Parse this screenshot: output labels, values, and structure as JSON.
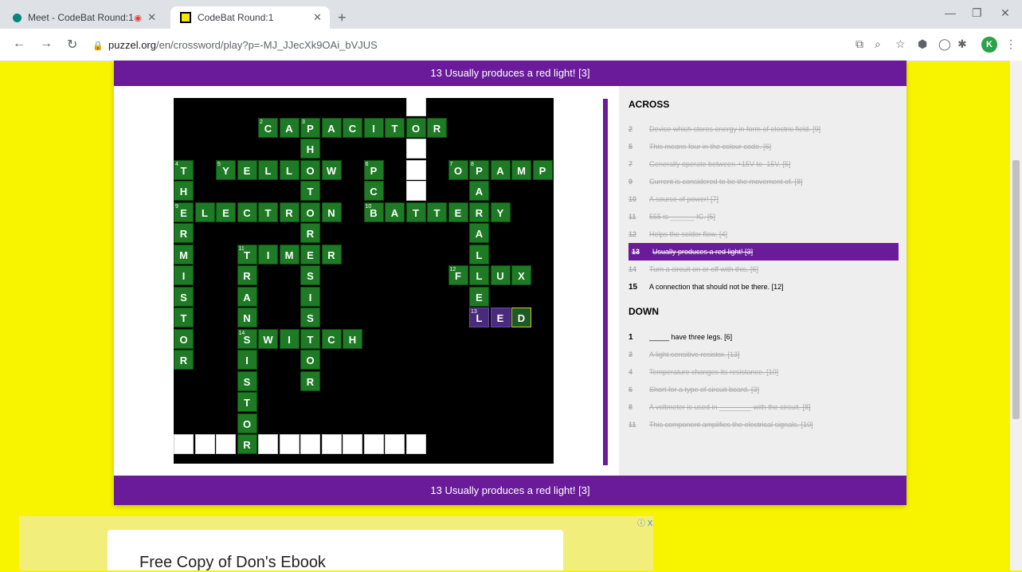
{
  "browser": {
    "tabs": [
      {
        "title": "Meet - CodeBat Round:1",
        "active": false
      },
      {
        "title": "CodeBat Round:1",
        "active": true
      }
    ],
    "url_host": "puzzel.org",
    "url_path": "/en/crossword/play?p=-MJ_JJecXk9OAi_bVJUS",
    "avatar_letter": "K"
  },
  "crossword": {
    "current_clue_banner": "13   Usually produces a red light! [3]",
    "across_heading": "ACROSS",
    "down_heading": "DOWN",
    "across": [
      {
        "n": "2",
        "text": "Device which stores energy in form of electric field. [9]",
        "state": "done"
      },
      {
        "n": "5",
        "text": "This means four in the colour code. [6]",
        "state": "done"
      },
      {
        "n": "7",
        "text": "Generally operate between +15V to -15V. [5]",
        "state": "done"
      },
      {
        "n": "9",
        "text": "Current is considered to be the movement of. [8]",
        "state": "done"
      },
      {
        "n": "10",
        "text": "A source of power! [7]",
        "state": "done"
      },
      {
        "n": "11",
        "text": "555 is ______ IC. [5]",
        "state": "done"
      },
      {
        "n": "12",
        "text": "Helps the solder flow. [4]",
        "state": "done"
      },
      {
        "n": "13",
        "text": "Usually produces a red light! [3]",
        "state": "active"
      },
      {
        "n": "14",
        "text": "Turn a circuit on or off with this. [6]",
        "state": "done"
      },
      {
        "n": "15",
        "text": "A connection that should not be there. [12]",
        "state": "open"
      }
    ],
    "down": [
      {
        "n": "1",
        "text": "_____ have three legs. [6]",
        "state": "open"
      },
      {
        "n": "3",
        "text": "A light sensitive resistor. [13]",
        "state": "done"
      },
      {
        "n": "4",
        "text": "Temperature changes its resistance. [10]",
        "state": "done"
      },
      {
        "n": "6",
        "text": "Short for a type of circuit board. [3]",
        "state": "done"
      },
      {
        "n": "8",
        "text": "A voltmeter is used in ________ with the circuit. [8]",
        "state": "done"
      },
      {
        "n": "11",
        "text": "This component amplifies the electrical signals. [10]",
        "state": "done"
      }
    ],
    "cells": [
      {
        "r": 0,
        "c": 11,
        "t": "white",
        "n": "1"
      },
      {
        "r": 1,
        "c": 4,
        "t": "green",
        "ch": "C",
        "n": "2"
      },
      {
        "r": 1,
        "c": 5,
        "t": "green",
        "ch": "A"
      },
      {
        "r": 1,
        "c": 6,
        "t": "green",
        "ch": "P",
        "n": "3"
      },
      {
        "r": 1,
        "c": 7,
        "t": "green",
        "ch": "A"
      },
      {
        "r": 1,
        "c": 8,
        "t": "green",
        "ch": "C"
      },
      {
        "r": 1,
        "c": 9,
        "t": "green",
        "ch": "I"
      },
      {
        "r": 1,
        "c": 10,
        "t": "green",
        "ch": "T"
      },
      {
        "r": 1,
        "c": 11,
        "t": "green",
        "ch": "O"
      },
      {
        "r": 1,
        "c": 12,
        "t": "green",
        "ch": "R"
      },
      {
        "r": 2,
        "c": 6,
        "t": "green",
        "ch": "H"
      },
      {
        "r": 2,
        "c": 11,
        "t": "white"
      },
      {
        "r": 3,
        "c": 0,
        "t": "green",
        "ch": "T",
        "n": "4"
      },
      {
        "r": 3,
        "c": 2,
        "t": "green",
        "ch": "Y",
        "n": "5"
      },
      {
        "r": 3,
        "c": 3,
        "t": "green",
        "ch": "E"
      },
      {
        "r": 3,
        "c": 4,
        "t": "green",
        "ch": "L"
      },
      {
        "r": 3,
        "c": 5,
        "t": "green",
        "ch": "L"
      },
      {
        "r": 3,
        "c": 6,
        "t": "green",
        "ch": "O"
      },
      {
        "r": 3,
        "c": 7,
        "t": "green",
        "ch": "W"
      },
      {
        "r": 3,
        "c": 9,
        "t": "green",
        "ch": "P",
        "n": "6"
      },
      {
        "r": 3,
        "c": 11,
        "t": "white"
      },
      {
        "r": 3,
        "c": 13,
        "t": "green",
        "ch": "O",
        "n": "7"
      },
      {
        "r": 3,
        "c": 14,
        "t": "green",
        "ch": "P",
        "n": "8"
      },
      {
        "r": 3,
        "c": 15,
        "t": "green",
        "ch": "A"
      },
      {
        "r": 3,
        "c": 16,
        "t": "green",
        "ch": "M"
      },
      {
        "r": 3,
        "c": 17,
        "t": "green",
        "ch": "P"
      },
      {
        "r": 4,
        "c": 0,
        "t": "green",
        "ch": "H"
      },
      {
        "r": 4,
        "c": 6,
        "t": "green",
        "ch": "T"
      },
      {
        "r": 4,
        "c": 9,
        "t": "green",
        "ch": "C"
      },
      {
        "r": 4,
        "c": 11,
        "t": "white"
      },
      {
        "r": 4,
        "c": 14,
        "t": "green",
        "ch": "A"
      },
      {
        "r": 5,
        "c": 0,
        "t": "green",
        "ch": "E",
        "n": "9"
      },
      {
        "r": 5,
        "c": 1,
        "t": "green",
        "ch": "L"
      },
      {
        "r": 5,
        "c": 2,
        "t": "green",
        "ch": "E"
      },
      {
        "r": 5,
        "c": 3,
        "t": "green",
        "ch": "C"
      },
      {
        "r": 5,
        "c": 4,
        "t": "green",
        "ch": "T"
      },
      {
        "r": 5,
        "c": 5,
        "t": "green",
        "ch": "R"
      },
      {
        "r": 5,
        "c": 6,
        "t": "green",
        "ch": "O"
      },
      {
        "r": 5,
        "c": 7,
        "t": "green",
        "ch": "N"
      },
      {
        "r": 5,
        "c": 9,
        "t": "green",
        "ch": "B",
        "n": "10"
      },
      {
        "r": 5,
        "c": 10,
        "t": "green",
        "ch": "A"
      },
      {
        "r": 5,
        "c": 11,
        "t": "green",
        "ch": "T"
      },
      {
        "r": 5,
        "c": 12,
        "t": "green",
        "ch": "T"
      },
      {
        "r": 5,
        "c": 13,
        "t": "green",
        "ch": "E"
      },
      {
        "r": 5,
        "c": 14,
        "t": "green",
        "ch": "R"
      },
      {
        "r": 5,
        "c": 15,
        "t": "green",
        "ch": "Y"
      },
      {
        "r": 6,
        "c": 0,
        "t": "green",
        "ch": "R"
      },
      {
        "r": 6,
        "c": 6,
        "t": "green",
        "ch": "R"
      },
      {
        "r": 6,
        "c": 14,
        "t": "green",
        "ch": "A"
      },
      {
        "r": 7,
        "c": 0,
        "t": "green",
        "ch": "M"
      },
      {
        "r": 7,
        "c": 3,
        "t": "green",
        "ch": "T",
        "n": "11"
      },
      {
        "r": 7,
        "c": 4,
        "t": "green",
        "ch": "I"
      },
      {
        "r": 7,
        "c": 5,
        "t": "green",
        "ch": "M"
      },
      {
        "r": 7,
        "c": 6,
        "t": "green",
        "ch": "E"
      },
      {
        "r": 7,
        "c": 7,
        "t": "green",
        "ch": "R"
      },
      {
        "r": 7,
        "c": 14,
        "t": "green",
        "ch": "L"
      },
      {
        "r": 8,
        "c": 0,
        "t": "green",
        "ch": "I"
      },
      {
        "r": 8,
        "c": 3,
        "t": "green",
        "ch": "R"
      },
      {
        "r": 8,
        "c": 6,
        "t": "green",
        "ch": "S"
      },
      {
        "r": 8,
        "c": 13,
        "t": "green",
        "ch": "F",
        "n": "12"
      },
      {
        "r": 8,
        "c": 14,
        "t": "green",
        "ch": "L"
      },
      {
        "r": 8,
        "c": 15,
        "t": "green",
        "ch": "U"
      },
      {
        "r": 8,
        "c": 16,
        "t": "green",
        "ch": "X"
      },
      {
        "r": 9,
        "c": 0,
        "t": "green",
        "ch": "S"
      },
      {
        "r": 9,
        "c": 3,
        "t": "green",
        "ch": "A"
      },
      {
        "r": 9,
        "c": 6,
        "t": "green",
        "ch": "I"
      },
      {
        "r": 9,
        "c": 14,
        "t": "green",
        "ch": "E"
      },
      {
        "r": 10,
        "c": 0,
        "t": "green",
        "ch": "T"
      },
      {
        "r": 10,
        "c": 3,
        "t": "green",
        "ch": "N"
      },
      {
        "r": 10,
        "c": 6,
        "t": "green",
        "ch": "S"
      },
      {
        "r": 10,
        "c": 14,
        "t": "purple",
        "ch": "L",
        "n": "13"
      },
      {
        "r": 10,
        "c": 15,
        "t": "purple",
        "ch": "E"
      },
      {
        "r": 10,
        "c": 16,
        "t": "hl",
        "ch": "D"
      },
      {
        "r": 11,
        "c": 0,
        "t": "green",
        "ch": "O"
      },
      {
        "r": 11,
        "c": 3,
        "t": "green",
        "ch": "S",
        "n": "14"
      },
      {
        "r": 11,
        "c": 4,
        "t": "green",
        "ch": "W"
      },
      {
        "r": 11,
        "c": 5,
        "t": "green",
        "ch": "I"
      },
      {
        "r": 11,
        "c": 6,
        "t": "green",
        "ch": "T"
      },
      {
        "r": 11,
        "c": 7,
        "t": "green",
        "ch": "C"
      },
      {
        "r": 11,
        "c": 8,
        "t": "green",
        "ch": "H"
      },
      {
        "r": 12,
        "c": 0,
        "t": "green",
        "ch": "R"
      },
      {
        "r": 12,
        "c": 3,
        "t": "green",
        "ch": "I"
      },
      {
        "r": 12,
        "c": 6,
        "t": "green",
        "ch": "O"
      },
      {
        "r": 13,
        "c": 3,
        "t": "green",
        "ch": "S"
      },
      {
        "r": 13,
        "c": 6,
        "t": "green",
        "ch": "R"
      },
      {
        "r": 14,
        "c": 3,
        "t": "green",
        "ch": "T"
      },
      {
        "r": 15,
        "c": 3,
        "t": "green",
        "ch": "O"
      },
      {
        "r": 16,
        "c": 0,
        "t": "white",
        "n": "15"
      },
      {
        "r": 16,
        "c": 1,
        "t": "white"
      },
      {
        "r": 16,
        "c": 2,
        "t": "white"
      },
      {
        "r": 16,
        "c": 3,
        "t": "green",
        "ch": "R"
      },
      {
        "r": 16,
        "c": 4,
        "t": "white"
      },
      {
        "r": 16,
        "c": 5,
        "t": "white"
      },
      {
        "r": 16,
        "c": 6,
        "t": "white"
      },
      {
        "r": 16,
        "c": 7,
        "t": "white"
      },
      {
        "r": 16,
        "c": 8,
        "t": "white"
      },
      {
        "r": 16,
        "c": 9,
        "t": "white"
      },
      {
        "r": 16,
        "c": 10,
        "t": "white"
      },
      {
        "r": 16,
        "c": 11,
        "t": "white"
      }
    ]
  },
  "ad": {
    "title": "Free Copy of Don's Ebook",
    "adchoices": "ⓘ X"
  }
}
